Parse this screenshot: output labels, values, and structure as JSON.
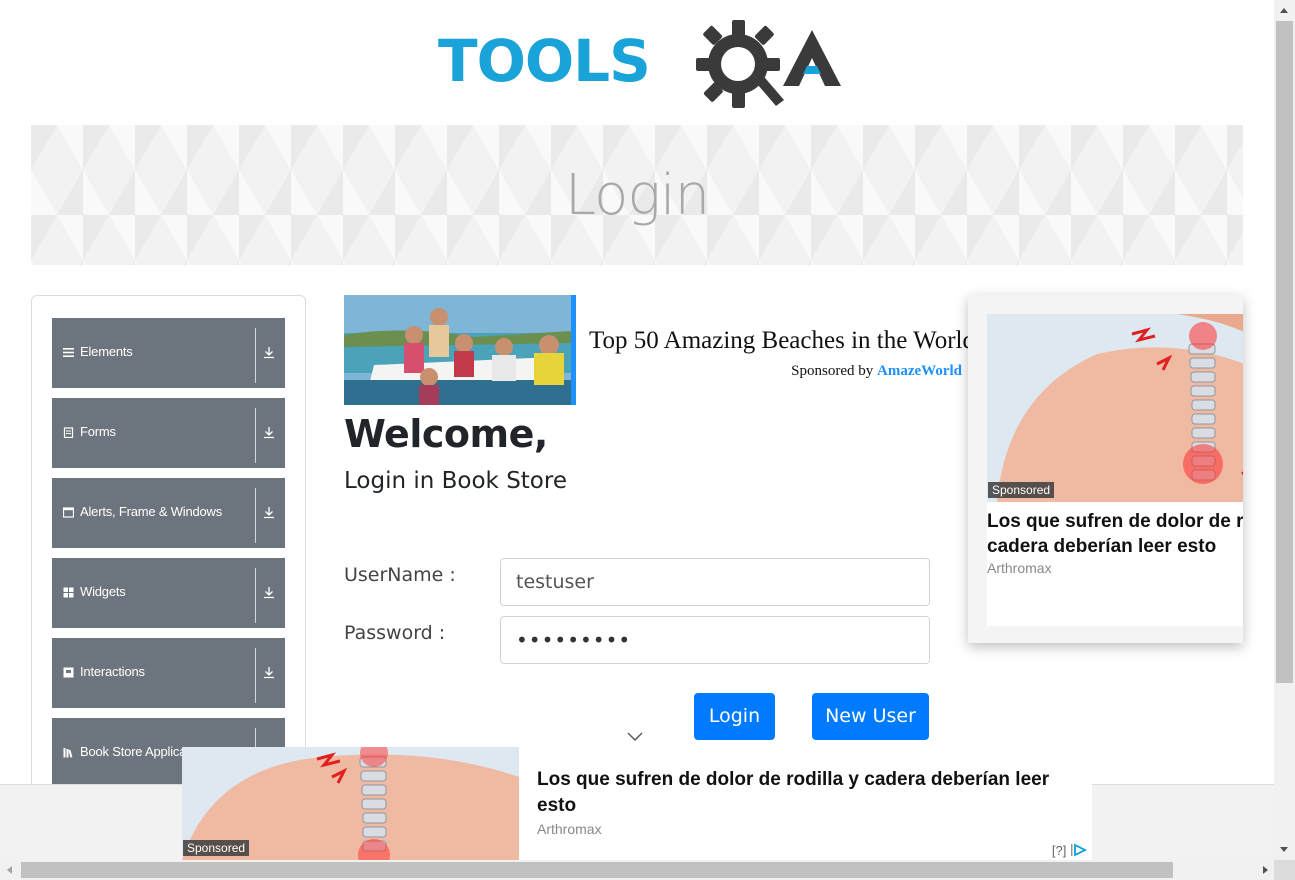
{
  "logo": {
    "text_left": "TOOLS",
    "text_right": "QA"
  },
  "banner": {
    "title": "Login"
  },
  "sidebar": {
    "items": [
      {
        "label": "Elements",
        "icon": "hamburger-icon"
      },
      {
        "label": "Forms",
        "icon": "document-icon"
      },
      {
        "label": "Alerts, Frame & Windows",
        "icon": "window-icon"
      },
      {
        "label": "Widgets",
        "icon": "grid-icon"
      },
      {
        "label": "Interactions",
        "icon": "box-icon"
      },
      {
        "label": "Book Store Applica",
        "icon": "books-icon"
      }
    ]
  },
  "top_ad": {
    "title": "Top 50 Amazing Beaches in the World",
    "sponsored_prefix": "Sponsored by",
    "sponsor": "AmazeWorld"
  },
  "main": {
    "welcome": "Welcome,",
    "subtitle": "Login in Book Store",
    "username_label": "UserName :",
    "username_value": "testuser",
    "password_label": "Password :",
    "password_value": "•••••••••",
    "login_button": "Login",
    "new_user_button": "New User"
  },
  "side_ad": {
    "tag": "Sponsored",
    "headline_line1": "Los que sufren de dolor de rodilla y",
    "headline_line2": "cadera deberían leer esto",
    "brand": "Arthromax"
  },
  "bottom_ad": {
    "tag": "Sponsored",
    "headline": "Los que sufren de dolor de rodilla y cadera deberían leer esto",
    "brand": "Arthromax",
    "adchoice": "[?]"
  },
  "colors": {
    "logo_blue": "#1aa3d9",
    "logo_dark": "#3a3a3a",
    "menu_bg": "#6c757d",
    "primary_button": "#007bff",
    "ad_accent": "#1e90ff"
  }
}
